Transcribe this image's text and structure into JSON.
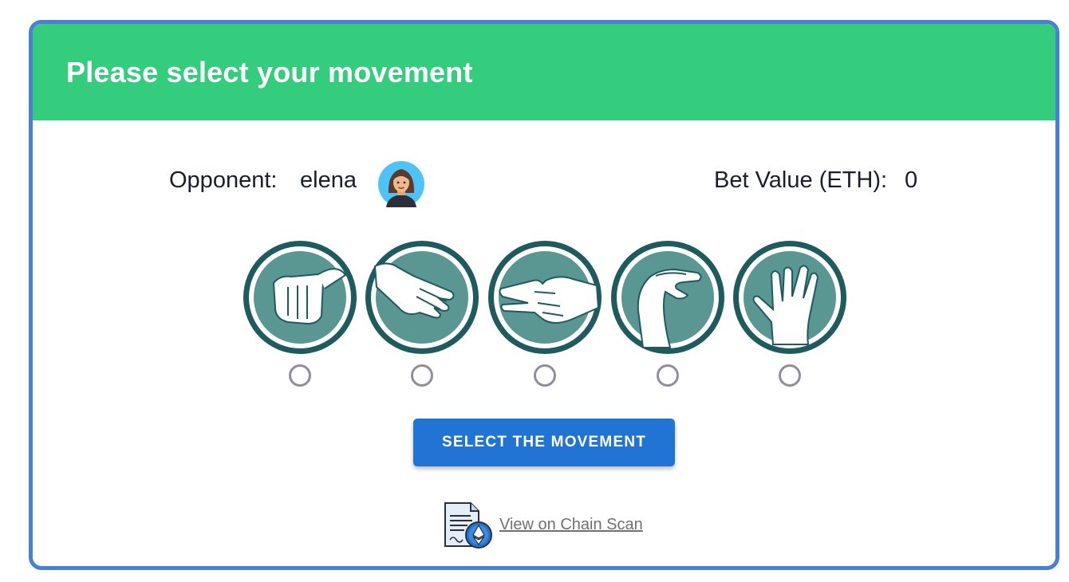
{
  "header": {
    "title": "Please select your movement"
  },
  "opponent": {
    "label": "Opponent:",
    "name": "elena",
    "avatar": "woman-avatar"
  },
  "bet": {
    "label": "Bet Value (ETH):",
    "value": "0"
  },
  "moves": [
    {
      "icon": "rock-fist-icon",
      "selected": false
    },
    {
      "icon": "paper-hand-icon",
      "selected": false
    },
    {
      "icon": "scissors-hand-icon",
      "selected": false
    },
    {
      "icon": "lizard-hand-icon",
      "selected": false
    },
    {
      "icon": "spock-hand-icon",
      "selected": false
    }
  ],
  "actions": {
    "select_label": "SELECT THE MOVEMENT"
  },
  "scan": {
    "link_label": "View on Chain Scan",
    "icon": "ethereum-document-icon"
  },
  "colors": {
    "header_bg": "#33cd7d",
    "card_border": "#4a80d0",
    "button_bg": "#2174d4",
    "emblem_outer": "#1f5a5e",
    "emblem_inner": "#5a9692"
  }
}
